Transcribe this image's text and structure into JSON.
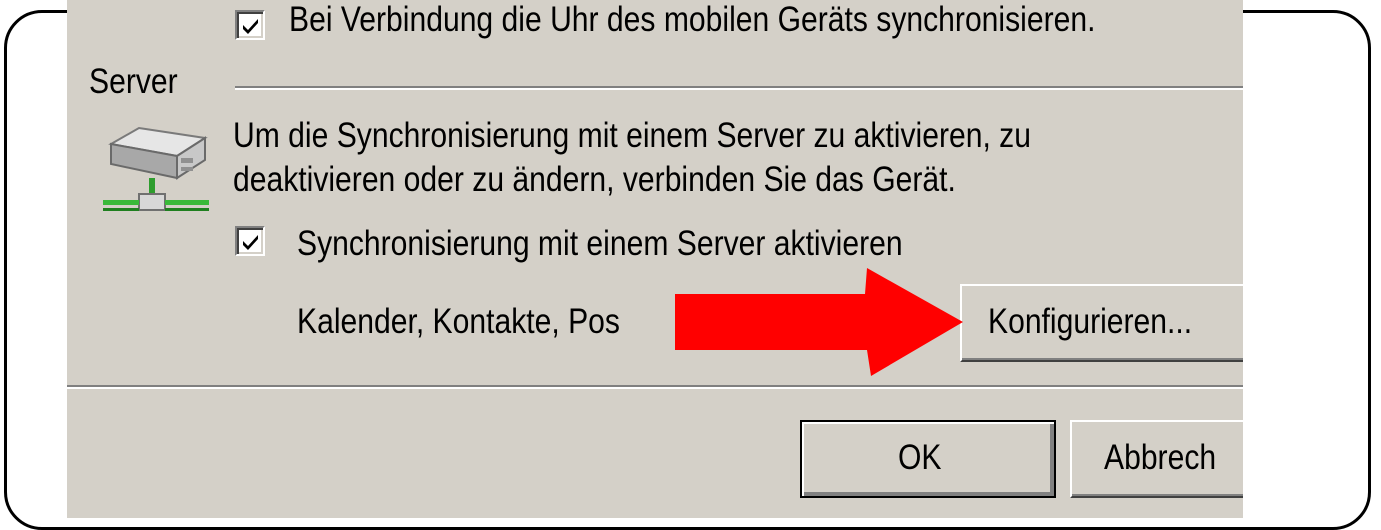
{
  "sync_clock": {
    "checked": true,
    "label": "Bei Verbindung die Uhr des mobilen Geräts synchronisieren."
  },
  "server": {
    "section_label": "Server",
    "icon": "network-server-icon",
    "description_line1": "Um die Synchronisierung mit einem Server zu aktivieren, zu",
    "description_line2": "deaktivieren oder zu ändern, verbinden Sie das Gerät.",
    "enable_checkbox": {
      "checked": true,
      "label": "Synchronisierung mit einem Server aktivieren"
    },
    "items_text": "Kalender, Kontakte, Pos",
    "configure_button": "Konfigurieren..."
  },
  "footer": {
    "ok_button": "OK",
    "cancel_button": "Abbrech"
  },
  "annotation": {
    "type": "red-arrow",
    "color": "#ff0000",
    "points_to": "configure-button"
  },
  "colors": {
    "dialog_background": "#d4d0c8",
    "frame_border": "#000000"
  }
}
